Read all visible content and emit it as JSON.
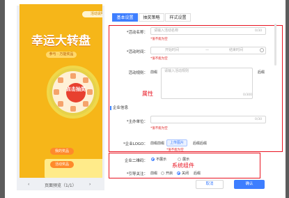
{
  "preview": {
    "badge": "活动说明",
    "title": "幸运大转盘",
    "subtitle": "参与 · 万能奖品",
    "center_label": "点击抽奖",
    "my_prizes": "我的奖品",
    "activity_prizes": "活动奖品",
    "pager_label": "页面预览（1/1）",
    "prev": "‹",
    "next": "›"
  },
  "tabs": [
    "基本设置",
    "抽奖策略",
    "样式设置"
  ],
  "form": {
    "name_label": "*活动名称：",
    "name_placeholder": "请输入活动名称",
    "name_count": "0/30",
    "name_error": "*值不能为空",
    "time_label": "*活动时间：",
    "time_start": "开始时间",
    "time_sep": "—",
    "time_end": "结束时间",
    "time_error": "*值不能为空",
    "rule_label": "活动规则：",
    "rule_prefix": "前缀",
    "rule_placeholder": "请输入活动规则",
    "rule_suffix": "后缀",
    "rule_count": "0/300",
    "section_title": "企业信息",
    "org_label": "*主办单位：",
    "org_count": "0/30",
    "org_error": "*值不能为空",
    "logo_label": "*企业LOGO：",
    "logo_prefix": "前缀前缀",
    "logo_button": "上传图片",
    "logo_suffix": "后缀后缀",
    "logo_error": "*值不能为空",
    "qr_label": "企业二维码：",
    "qr_opt1": "不展示",
    "qr_opt2": "展示",
    "follow_label": "*引导关注：",
    "follow_prefix": "前缀",
    "follow_opt1": "开启",
    "follow_opt2": "关闭",
    "follow_suffix": "后缀"
  },
  "annotations": {
    "attributes": "属性",
    "system_component": "系统组件"
  },
  "buttons": {
    "cancel": "取消",
    "ok": "确认"
  },
  "colors": {
    "accent": "#3d7eff",
    "annotation": "#e8121f",
    "preview_bg": "#f6b619"
  }
}
